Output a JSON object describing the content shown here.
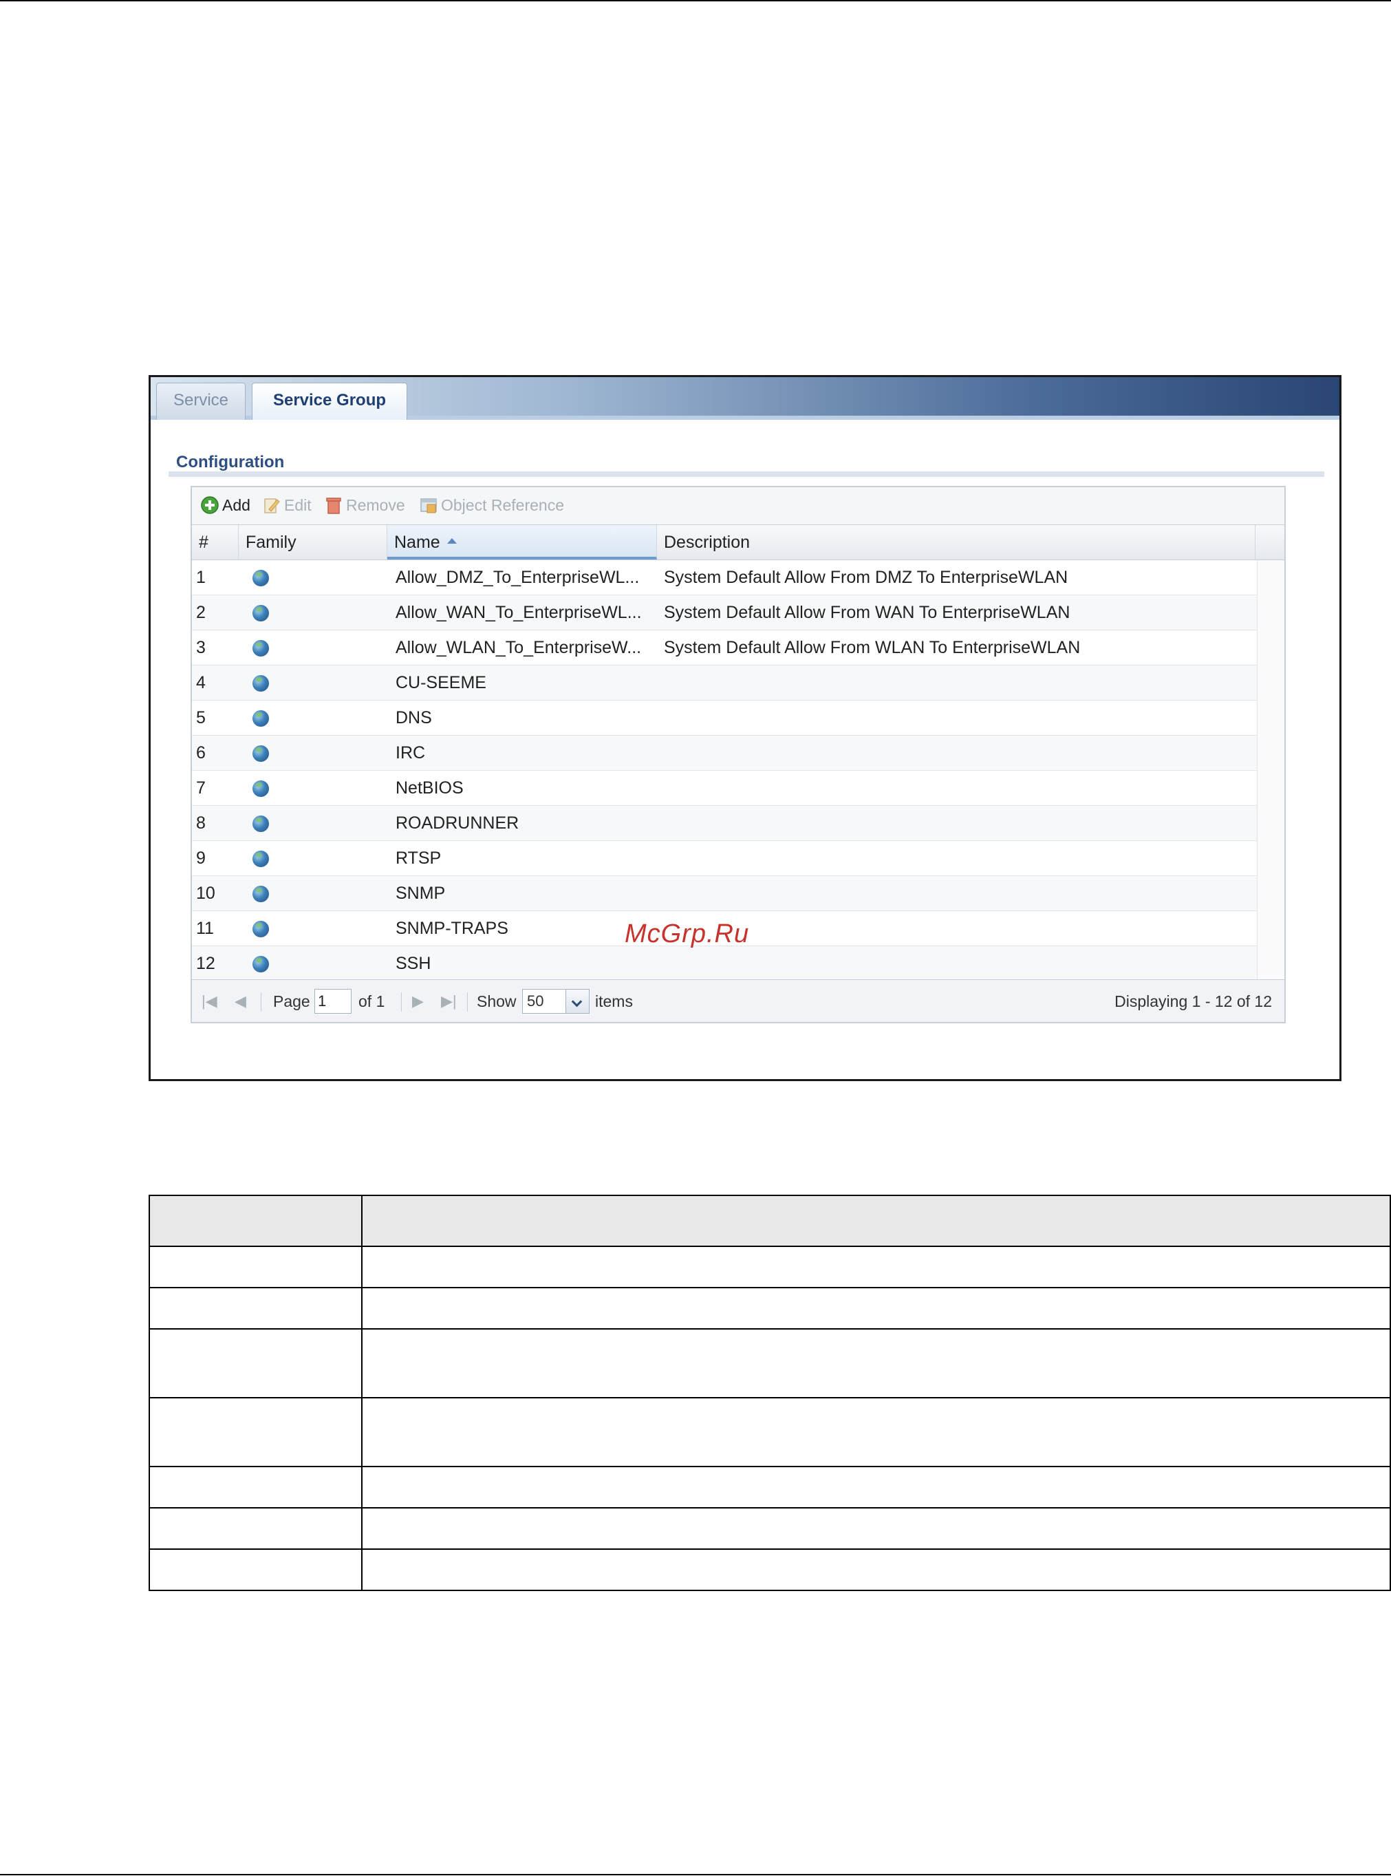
{
  "tabs": [
    {
      "label": "Service",
      "active": false
    },
    {
      "label": "Service Group",
      "active": true
    }
  ],
  "section_title": "Configuration",
  "toolbar": {
    "add": "Add",
    "edit": "Edit",
    "remove": "Remove",
    "object_reference": "Object Reference"
  },
  "table": {
    "columns": [
      "#",
      "Family",
      "Name",
      "Description"
    ],
    "sorted_column": "Name",
    "rows": [
      {
        "num": "1",
        "family_icon": "globe-icon",
        "name": "Allow_DMZ_To_EnterpriseWL...",
        "description": "System Default Allow From DMZ To EnterpriseWLAN"
      },
      {
        "num": "2",
        "family_icon": "globe-icon",
        "name": "Allow_WAN_To_EnterpriseWL...",
        "description": "System Default Allow From WAN To EnterpriseWLAN"
      },
      {
        "num": "3",
        "family_icon": "globe-icon",
        "name": "Allow_WLAN_To_EnterpriseW...",
        "description": "System Default Allow From WLAN To EnterpriseWLAN"
      },
      {
        "num": "4",
        "family_icon": "globe-icon",
        "name": "CU-SEEME",
        "description": ""
      },
      {
        "num": "5",
        "family_icon": "globe-icon",
        "name": "DNS",
        "description": ""
      },
      {
        "num": "6",
        "family_icon": "globe-icon",
        "name": "IRC",
        "description": ""
      },
      {
        "num": "7",
        "family_icon": "globe-icon",
        "name": "NetBIOS",
        "description": ""
      },
      {
        "num": "8",
        "family_icon": "globe-icon",
        "name": "ROADRUNNER",
        "description": ""
      },
      {
        "num": "9",
        "family_icon": "globe-icon",
        "name": "RTSP",
        "description": ""
      },
      {
        "num": "10",
        "family_icon": "globe-icon",
        "name": "SNMP",
        "description": ""
      },
      {
        "num": "11",
        "family_icon": "globe-icon",
        "name": "SNMP-TRAPS",
        "description": ""
      },
      {
        "num": "12",
        "family_icon": "globe-icon",
        "name": "SSH",
        "description": ""
      }
    ]
  },
  "pager": {
    "page_label": "Page",
    "page_value": "1",
    "of_label": "of 1",
    "show_label": "Show",
    "show_value": "50",
    "items_label": "items",
    "displaying": "Displaying 1 - 12 of 12"
  },
  "watermark": "McGrp.Ru",
  "colors": {
    "tab_active_text": "#1f3f73",
    "section_title": "#2e4f83",
    "sort_accent": "#6f9ccf",
    "watermark": "#c8322d"
  }
}
